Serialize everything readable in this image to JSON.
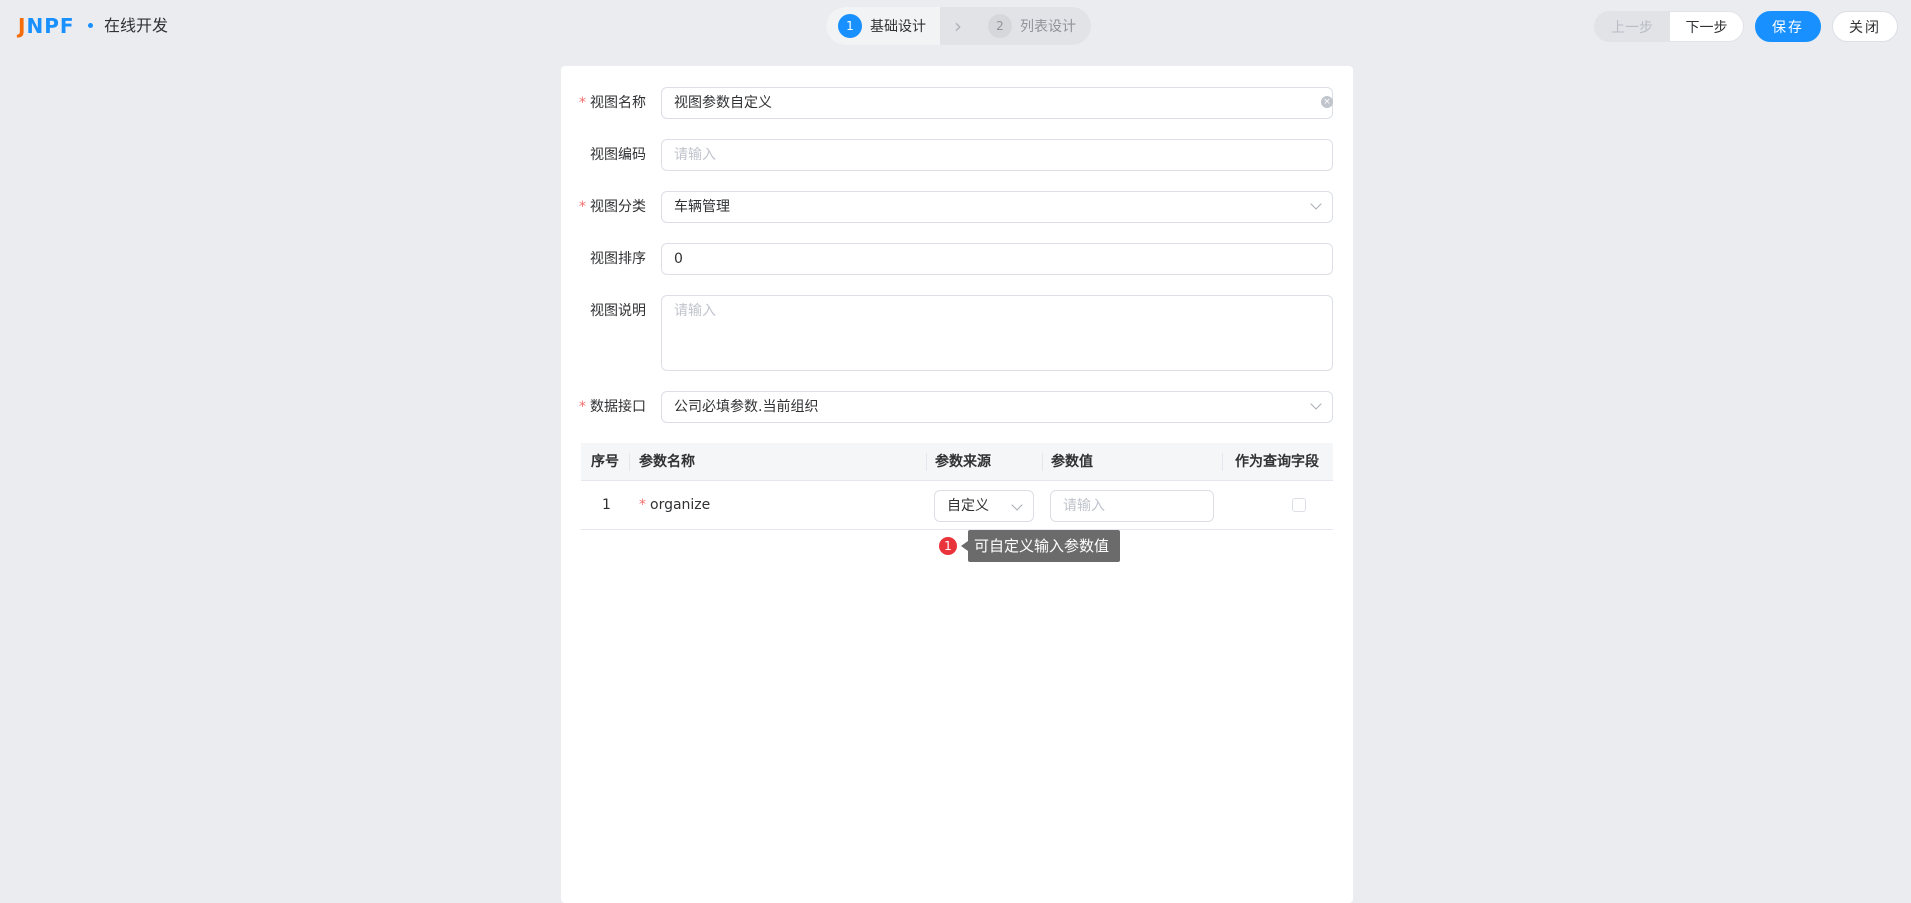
{
  "header": {
    "logo_j": "J",
    "logo_rest": "NPF",
    "title": "在线开发",
    "steps": [
      {
        "num": "1",
        "label": "基础设计"
      },
      {
        "num": "2",
        "label": "列表设计"
      }
    ],
    "prev_label": "上一步",
    "next_label": "下一步",
    "save_label": "保存",
    "close_label": "关闭"
  },
  "form": {
    "view_name": {
      "label": "视图名称",
      "required": "*",
      "value": "视图参数自定义"
    },
    "view_code": {
      "label": "视图编码",
      "placeholder": "请输入"
    },
    "view_category": {
      "label": "视图分类",
      "required": "*",
      "value": "车辆管理"
    },
    "view_order": {
      "label": "视图排序",
      "value": "0"
    },
    "view_desc": {
      "label": "视图说明",
      "placeholder": "请输入"
    },
    "data_api": {
      "label": "数据接口",
      "required": "*",
      "value": "公司必填参数.当前组织"
    }
  },
  "table": {
    "columns": [
      "序号",
      "参数名称",
      "参数来源",
      "参数值",
      "作为查询字段"
    ],
    "rows": [
      {
        "index": "1",
        "required": "*",
        "name": "organize",
        "source": "自定义",
        "value_placeholder": "请输入"
      }
    ]
  },
  "annotation": {
    "badge": "1",
    "text": "可自定义输入参数值"
  },
  "colors": {
    "primary": "#1890ff",
    "required": "#f56c6c",
    "badge": "#e8343a",
    "logo_accent": "#f56c0a"
  }
}
